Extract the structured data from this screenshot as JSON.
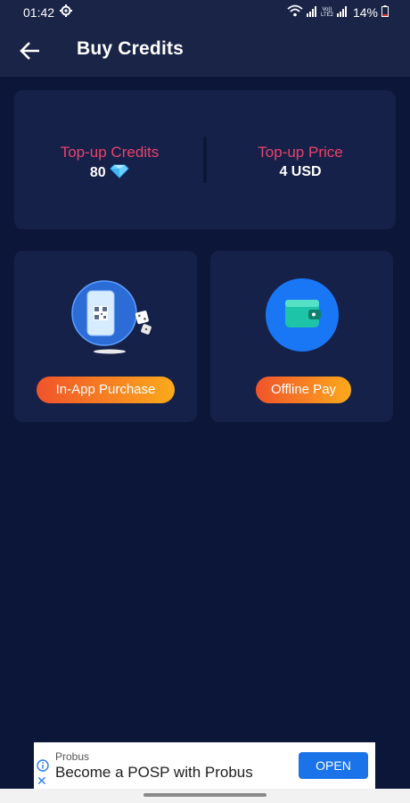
{
  "status_bar": {
    "time": "01:42",
    "network_tag": "Vo)) LTE2",
    "battery": "14%",
    "icons": [
      "settings-gear-icon",
      "wifi-icon",
      "signal-icon",
      "battery-icon"
    ]
  },
  "header": {
    "title": "Buy Credits",
    "back_icon": "arrow-left-icon"
  },
  "summary": {
    "credits_label": "Top-up Credits",
    "credits_value": "80",
    "credits_icon": "diamond-icon",
    "price_label": "Top-up Price",
    "price_value": "4 USD"
  },
  "payment_options": [
    {
      "label": "In-App Purchase",
      "icon": "phone-qr-code-icon"
    },
    {
      "label": "Offline Pay",
      "icon": "wallet-icon"
    }
  ],
  "ad": {
    "brand": "Probus",
    "headline": "Become a POSP with Probus",
    "cta": "OPEN",
    "icons": [
      "info-icon",
      "close-icon"
    ]
  },
  "colors": {
    "background": "#0b1638",
    "app_bar": "#1a2447",
    "card": "#162149",
    "label_accent": "#e8436b",
    "button_gradient_start": "#f0532a",
    "button_gradient_end": "#fbaa1c",
    "ad_cta": "#1a73e8"
  }
}
